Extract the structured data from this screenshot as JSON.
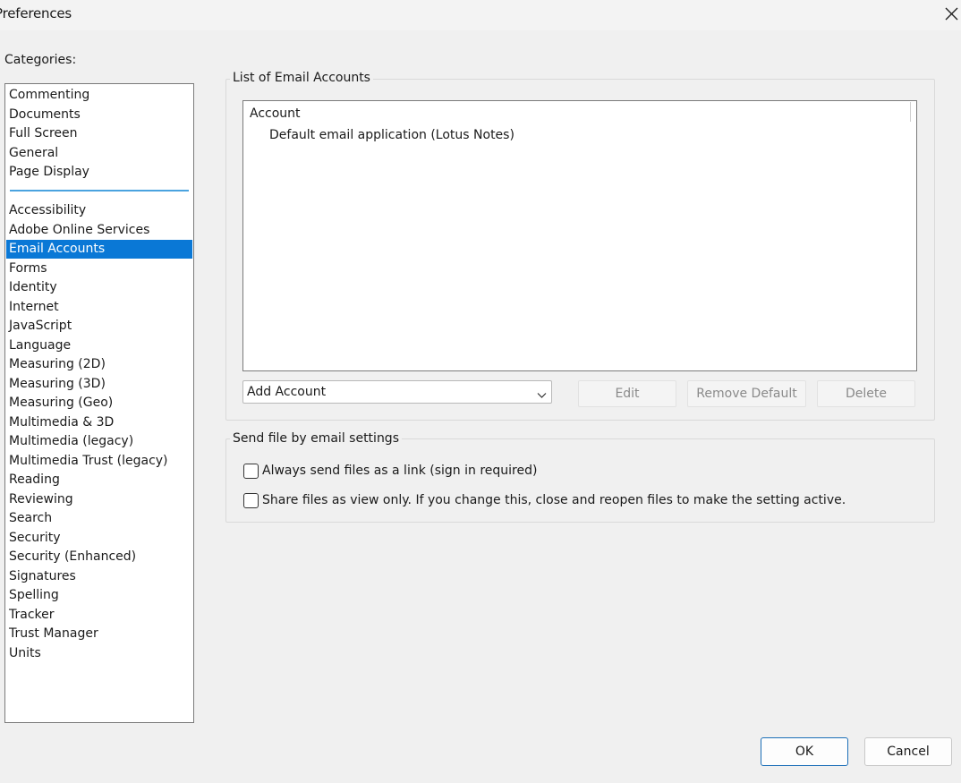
{
  "window": {
    "title": "Preferences",
    "close_icon": "close-icon"
  },
  "categories": {
    "label": "Categories:",
    "top_items": [
      "Commenting",
      "Documents",
      "Full Screen",
      "General",
      "Page Display"
    ],
    "items": [
      "Accessibility",
      "Adobe Online Services",
      "Email Accounts",
      "Forms",
      "Identity",
      "Internet",
      "JavaScript",
      "Language",
      "Measuring (2D)",
      "Measuring (3D)",
      "Measuring (Geo)",
      "Multimedia & 3D",
      "Multimedia (legacy)",
      "Multimedia Trust (legacy)",
      "Reading",
      "Reviewing",
      "Search",
      "Security",
      "Security (Enhanced)",
      "Signatures",
      "Spelling",
      "Tracker",
      "Trust Manager",
      "Units"
    ],
    "selected": "Email Accounts",
    "selected_color": "#0a78d6"
  },
  "email_accounts": {
    "group_title": "List of Email Accounts",
    "column_header": "Account",
    "rows": [
      "Default email application (Lotus Notes)"
    ],
    "add_account": {
      "value": "Add Account"
    },
    "buttons": {
      "edit": "Edit",
      "remove_default": "Remove Default",
      "delete": "Delete"
    }
  },
  "send_settings": {
    "group_title": "Send file by email settings",
    "options": [
      {
        "label": "Always send files as a link (sign in required)",
        "checked": false
      },
      {
        "label": "Share files as view only. If you change this, close and reopen files to make the setting active.",
        "checked": false
      }
    ]
  },
  "footer": {
    "ok": "OK",
    "cancel": "Cancel"
  }
}
